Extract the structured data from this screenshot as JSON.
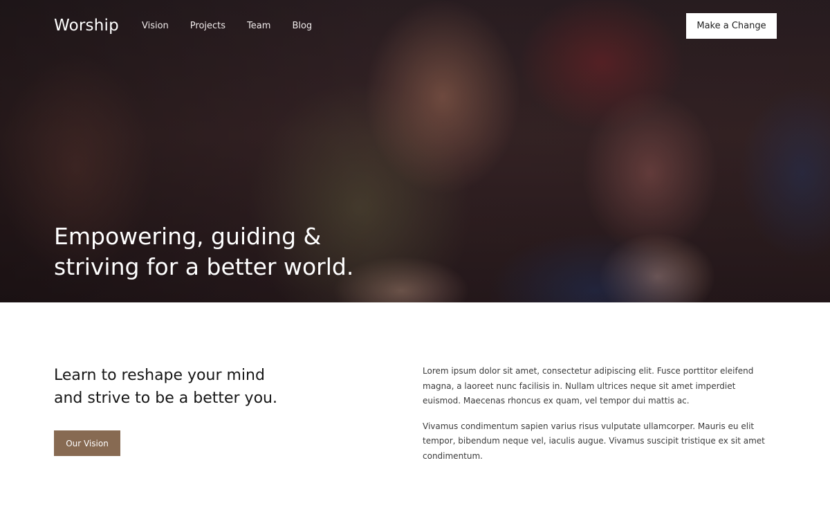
{
  "nav": {
    "brand": "Worship",
    "links": [
      "Vision",
      "Projects",
      "Team",
      "Blog"
    ],
    "cta_label": "Make a Change"
  },
  "hero": {
    "title_line1": "Empowering, guiding &",
    "title_line2": "striving for a better world."
  },
  "intro": {
    "lead_line1": "Learn to reshape your mind",
    "lead_line2": "and strive to be a better you.",
    "button_label": "Our Vision",
    "paragraphs": [
      "Lorem ipsum dolor sit amet, consectetur adipiscing elit. Fusce porttitor eleifend magna, a laoreet nunc facilisis in. Nullam ultrices neque sit amet imperdiet euismod. Maecenas rhoncus ex quam, vel tempor dui mattis ac.",
      "Vivamus condimentum sapien varius risus vulputate ullamcorper. Mauris eu elit tempor, bibendum neque vel, iaculis augue. Vivamus suscipit tristique ex sit amet condimentum."
    ]
  },
  "colors": {
    "accent_button": "#876a52",
    "hero_overlay": "#2a1d1f",
    "cta_background": "#ffffff"
  }
}
